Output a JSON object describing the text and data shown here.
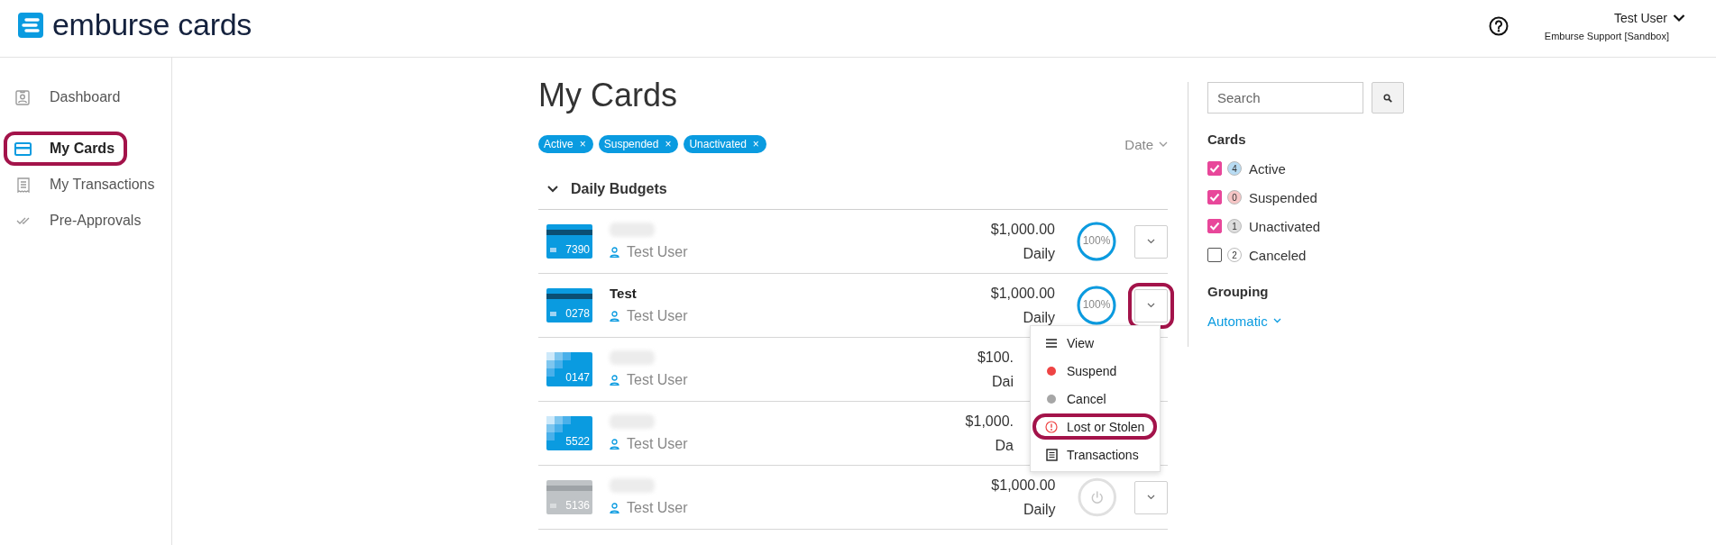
{
  "header": {
    "logo_text": "emburse cards",
    "user_name": "Test User",
    "user_org": "Emburse Support [Sandbox]"
  },
  "sidebar": {
    "items": [
      {
        "label": "Dashboard",
        "selected": false,
        "annotated": false
      },
      {
        "label": "My Cards",
        "selected": true,
        "annotated": true
      },
      {
        "label": "My Transactions",
        "selected": false,
        "annotated": false
      },
      {
        "label": "Pre-Approvals",
        "selected": false,
        "annotated": false
      }
    ]
  },
  "page_title": "My Cards",
  "filter_chips": [
    {
      "label": "Active",
      "remove": "×"
    },
    {
      "label": "Suspended",
      "remove": "×"
    },
    {
      "label": "Unactivated",
      "remove": "×"
    }
  ],
  "sort": {
    "label": "Date"
  },
  "group": {
    "title": "Daily Budgets",
    "expanded": true,
    "cards": [
      {
        "last4": "7390",
        "kind": "stripe",
        "activated": true,
        "name_redacted": true,
        "holder": "Test User",
        "amount": "$1,000.00",
        "period": "Daily",
        "usage": "100%",
        "level": 1,
        "covered_by_menu": false,
        "annotated": false
      },
      {
        "last4": "0278",
        "kind": "stripe",
        "activated": true,
        "name": "Test",
        "name_redacted": false,
        "holder": "Test User",
        "amount": "$1,000.00",
        "period": "Daily",
        "usage": "100%",
        "level": 1,
        "covered_by_menu": false,
        "annotated": true,
        "menu": {
          "items": [
            {
              "label": "View",
              "annotated": false
            },
            {
              "label": "Suspend",
              "color": "#ee4444",
              "annotated": false
            },
            {
              "label": "Cancel",
              "color": "#a6a6a6",
              "annotated": false
            },
            {
              "label": "Lost or Stolen",
              "annotated": true
            },
            {
              "label": "Transactions",
              "annotated": false
            }
          ]
        }
      },
      {
        "last4": "0147",
        "kind": "mosaic",
        "activated": true,
        "name_redacted": true,
        "holder": "Test User",
        "amount": "$100.",
        "period": "Dai",
        "covered_by_menu": true,
        "annotated": false
      },
      {
        "last4": "5522",
        "kind": "mosaic",
        "activated": true,
        "name_redacted": true,
        "holder": "Test User",
        "amount": "$1,000.",
        "period": "Da",
        "covered_by_menu": true,
        "annotated": false
      },
      {
        "last4": "5136",
        "kind": "stripe",
        "activated": false,
        "name_redacted": true,
        "holder": "Test User",
        "amount": "$1,000.00",
        "period": "Daily",
        "covered_by_menu": false,
        "annotated": false
      }
    ]
  },
  "filters": {
    "search": {
      "placeholder": "Search"
    },
    "cards_title": "Cards",
    "statuses": [
      {
        "label": "Active",
        "count": "4",
        "color": "#b8dcf3",
        "checked": true
      },
      {
        "label": "Suspended",
        "count": "0",
        "color": "#f7c6c6",
        "checked": true
      },
      {
        "label": "Unactivated",
        "count": "1",
        "color": "#dddddd",
        "checked": true
      },
      {
        "label": "Canceled",
        "count": "2",
        "color": "#ffffff",
        "checked": false
      }
    ],
    "grouping_title": "Grouping",
    "grouping_value": "Automatic"
  }
}
